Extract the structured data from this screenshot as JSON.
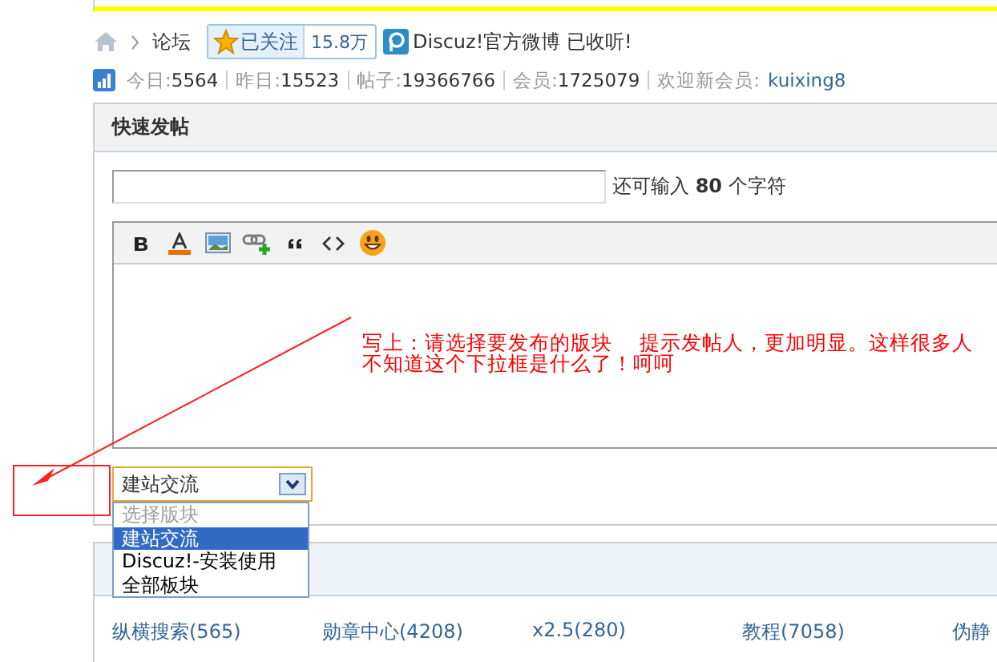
{
  "breadcrumb": {
    "items": [
      "论坛"
    ],
    "follow_button": {
      "label": "已关注",
      "count": "15.8万"
    },
    "weibo_text": "Discuz!官方微博 已收听!"
  },
  "stats": [
    {
      "label": "今日:",
      "value": "5564"
    },
    {
      "label": "昨日:",
      "value": "15523"
    },
    {
      "label": "帖子:",
      "value": "19366766"
    },
    {
      "label": "会员:",
      "value": "1725079"
    }
  ],
  "new_member": {
    "label": "欢迎新会员:",
    "name": "kuixing8"
  },
  "quick_post": {
    "title": "快速发帖",
    "subject_counter": "还可输入 **80** 个字符",
    "forum_select": {
      "value": "建站交流",
      "options": [
        {
          "label": "选择版块",
          "selected": false,
          "disabled": true
        },
        {
          "label": "建站交流",
          "selected": true,
          "disabled": false
        },
        {
          "label": "Discuz!-安装使用",
          "selected": false,
          "disabled": false
        },
        {
          "label": "全部板块",
          "selected": false,
          "disabled": false
        }
      ]
    }
  },
  "annotation": {
    "text": "写上：请选择要发布的版块　 提示发帖人，更加明显。这样很多人不知道这个下拉框是什么了！呵呵"
  },
  "forum_links": [
    "纵横搜索(565)",
    "勋章中心(4208)",
    "x2.5(280)",
    "教程(7058)",
    "伪静"
  ]
}
